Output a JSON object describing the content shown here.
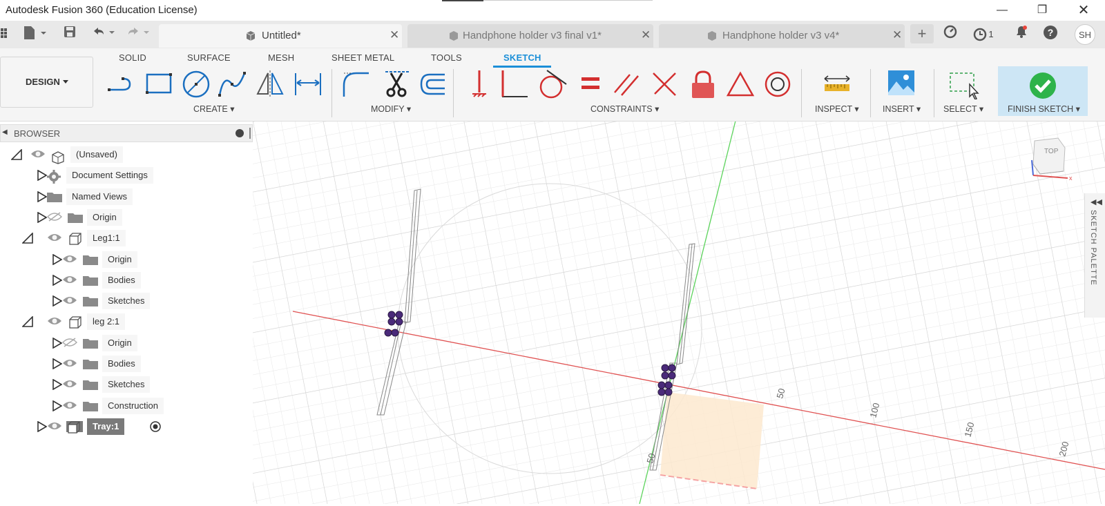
{
  "window": {
    "title": "Autodesk Fusion 360 (Education License)"
  },
  "tabs": [
    {
      "label": "Untitled*",
      "active": true
    },
    {
      "label": "Handphone holder v3 final v1*",
      "active": false
    },
    {
      "label": "Handphone holder v3 v4*",
      "active": false
    }
  ],
  "header_right": {
    "jobs_count": "1",
    "avatar": "SH"
  },
  "workspace_tabs": [
    "SOLID",
    "SURFACE",
    "MESH",
    "SHEET METAL",
    "TOOLS",
    "SKETCH"
  ],
  "selected_workspace_tab": "SKETCH",
  "design_button": "DESIGN",
  "groups": {
    "create": "CREATE",
    "modify": "MODIFY",
    "constraints": "CONSTRAINTS",
    "inspect": "INSPECT",
    "insert": "INSERT",
    "select": "SELECT",
    "finish": "FINISH SKETCH"
  },
  "browser": {
    "title": "BROWSER",
    "items": [
      {
        "label": "(Unsaved)",
        "expanded": true,
        "icon": "component-icon"
      },
      {
        "label": "Document Settings",
        "icon": "gear-icon"
      },
      {
        "label": "Named Views",
        "icon": "folder-icon"
      },
      {
        "label": "Origin",
        "icon": "folder-icon",
        "hidden": true
      },
      {
        "label": "Leg1:1",
        "expanded": true,
        "icon": "component-icon"
      },
      {
        "label": "Origin",
        "icon": "folder-icon"
      },
      {
        "label": "Bodies",
        "icon": "folder-icon"
      },
      {
        "label": "Sketches",
        "icon": "folder-icon"
      },
      {
        "label": "leg 2:1",
        "expanded": true,
        "icon": "component-icon"
      },
      {
        "label": "Origin",
        "icon": "folder-icon",
        "hidden": true
      },
      {
        "label": "Bodies",
        "icon": "folder-icon"
      },
      {
        "label": "Sketches",
        "icon": "folder-icon"
      },
      {
        "label": "Construction",
        "icon": "folder-icon"
      },
      {
        "label": "Tray:1",
        "icon": "component-icon",
        "active": true
      }
    ]
  },
  "viewport": {
    "axis_labels": [
      "50",
      "100",
      "150",
      "200",
      "50"
    ],
    "viewcube_label": "TOP",
    "sketch_palette": "SKETCH PALETTE"
  }
}
